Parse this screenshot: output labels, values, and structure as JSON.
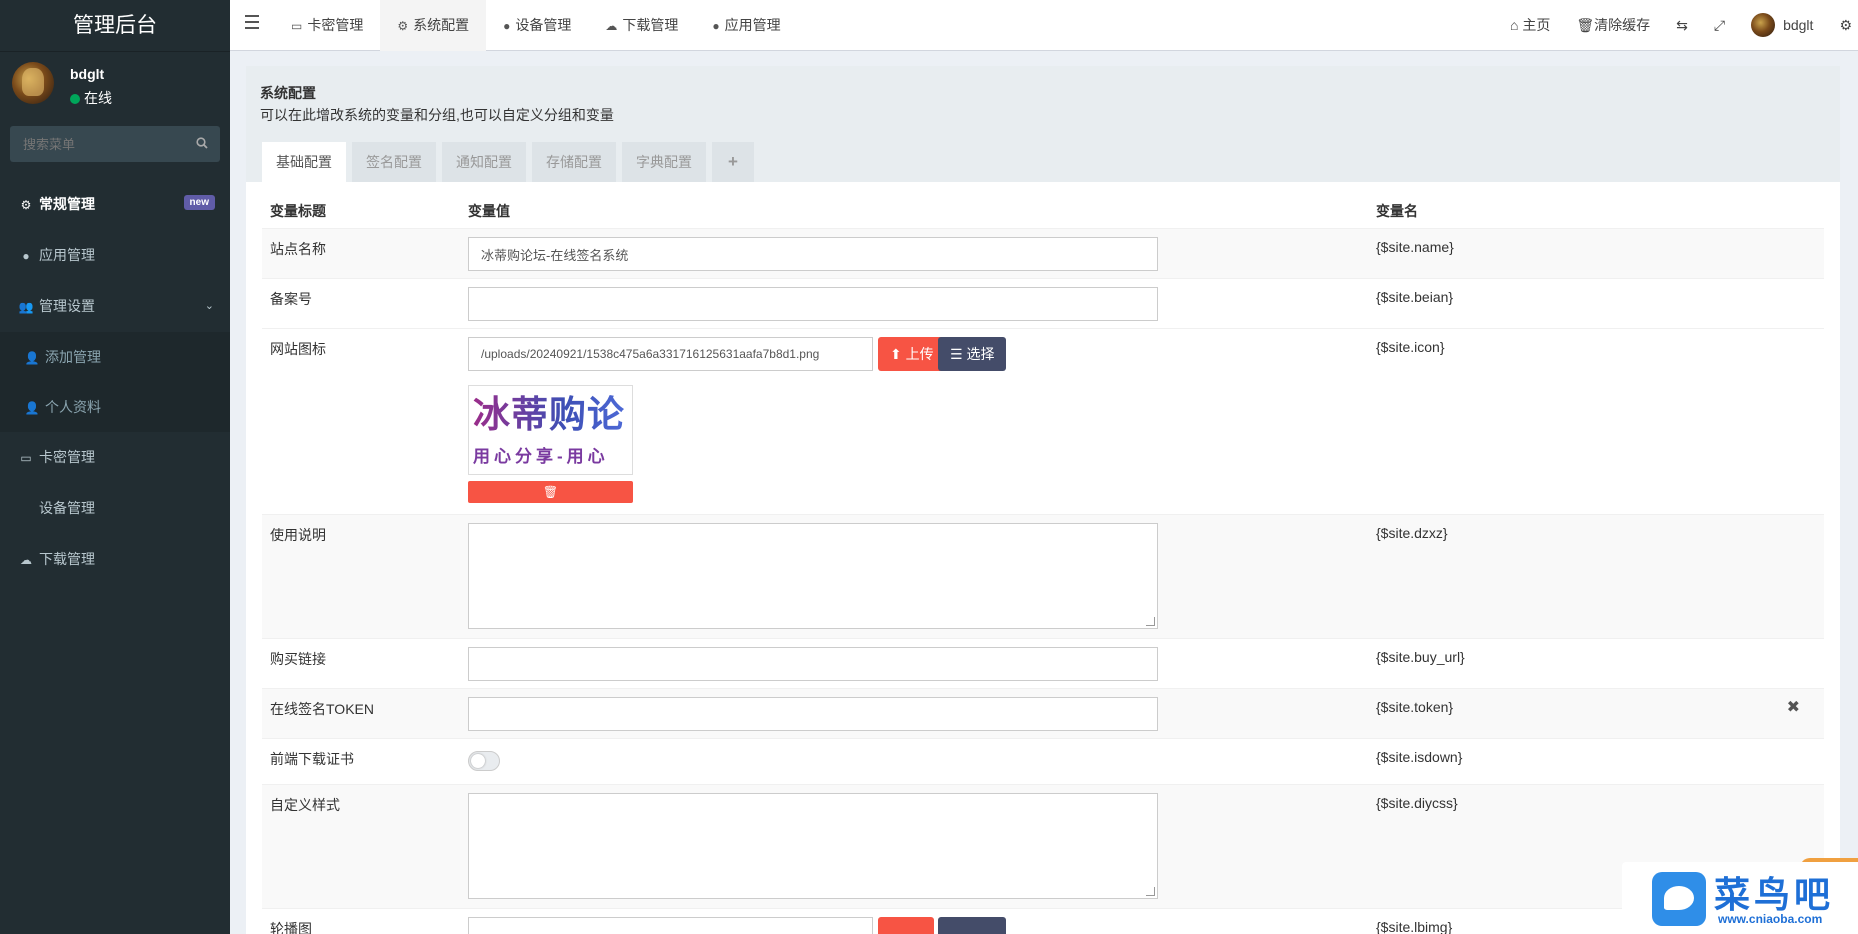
{
  "sidebar": {
    "logo": "管理后台",
    "user": {
      "name": "bdglt",
      "status": "在线"
    },
    "search_placeholder": "搜索菜单",
    "items": [
      {
        "label": "常规管理",
        "badge": "new",
        "icon": "cogs-icon"
      },
      {
        "label": "应用管理",
        "icon": "app-icon"
      },
      {
        "label": "管理设置",
        "icon": "users-icon"
      },
      {
        "label": "添加管理",
        "icon": "user-icon"
      },
      {
        "label": "个人资料",
        "icon": "user-icon"
      },
      {
        "label": "卡密管理",
        "icon": "credit-card-icon"
      },
      {
        "label": "设备管理",
        "icon": "apple-icon"
      },
      {
        "label": "下载管理",
        "icon": "cloud-download-icon"
      }
    ]
  },
  "topnav": {
    "tabs": [
      {
        "label": "卡密管理",
        "icon": "credit-card-icon"
      },
      {
        "label": "系统配置",
        "icon": "gear-icon"
      },
      {
        "label": "设备管理",
        "icon": "apple-icon"
      },
      {
        "label": "下载管理",
        "icon": "cloud-download-icon"
      },
      {
        "label": "应用管理",
        "icon": "app-icon"
      }
    ],
    "right": {
      "home": "主页",
      "clear_cache": "清除缓存",
      "user": "bdglt"
    }
  },
  "panel": {
    "title": "系统配置",
    "subtitle": "可以在此增改系统的变量和分组,也可以自定义分组和变量",
    "tabs": [
      "基础配置",
      "签名配置",
      "通知配置",
      "存储配置",
      "字典配置",
      "+"
    ]
  },
  "table": {
    "headers": {
      "title": "变量标题",
      "value": "变量值",
      "name": "变量名"
    },
    "rows": [
      {
        "title": "站点名称",
        "value": "冰蒂购论坛-在线签名系统",
        "name": "{$site.name}"
      },
      {
        "title": "备案号",
        "value": "",
        "name": "{$site.beian}"
      },
      {
        "title": "网站图标",
        "value": "/uploads/20240921/1538c475a6a331716125631aafa7b8d1.png",
        "name": "{$site.icon}",
        "upload": "上传",
        "choose": "选择"
      },
      {
        "title": "使用说明",
        "value": "",
        "name": "{$site.dzxz}"
      },
      {
        "title": "购买链接",
        "value": "",
        "name": "{$site.buy_url}"
      },
      {
        "title": "在线签名TOKEN",
        "value": "",
        "name": "{$site.token}",
        "remove": "✖"
      },
      {
        "title": "前端下载证书",
        "value": "off",
        "name": "{$site.isdown}"
      },
      {
        "title": "自定义样式",
        "value": "",
        "name": "{$site.diycss}"
      },
      {
        "title": "轮播图",
        "value": "",
        "name": "{$site.lbimg}"
      }
    ],
    "icon_preview": {
      "line1": "冰蒂购论",
      "line2": "用心分享-用心"
    }
  },
  "watermark": {
    "text": "菜鸟吧",
    "url": "www.cniaoba.com"
  }
}
